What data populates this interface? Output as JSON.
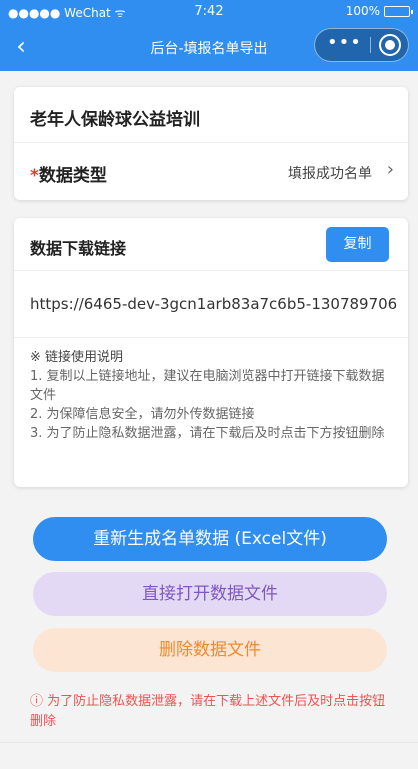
{
  "status_bar": {
    "carrier": "●●●●● WeChat",
    "wifi": "ᯤ",
    "time": "7:42",
    "battery": "100%",
    "battery_level": 1.0
  },
  "nav": {
    "back": "‹",
    "title": "后台-填报名单导出",
    "more": "•••"
  },
  "event_card": {
    "title": "老年人保龄球公益培训",
    "data_type_required_mark": "*",
    "data_type_label": "数据类型",
    "data_type_value": "填报成功名单",
    "chevron": "›"
  },
  "download_card": {
    "label": "数据下载链接",
    "copy_button": "复制",
    "url": "https://6465-dev-3gcn1arb83a7c6b5-130789706",
    "notes_title": "※ 链接使用说明",
    "notes": [
      "1. 复制以上链接地址，建议在电脑浏览器中打开链接下载数据文件",
      "2. 为保障信息安全，请勿外传数据链接",
      "3. 为了防止隐私数据泄露，请在下载后及时点击下方按钮删除"
    ]
  },
  "actions": {
    "regenerate": "重新生成名单数据 (Excel文件)",
    "open_file": "直接打开数据文件",
    "delete_file": "删除数据文件"
  },
  "warning": "ⓘ 为了防止隐私数据泄露，请在下载上述文件后及时点击按钮删除",
  "colors": {
    "primary": "#2f8ef0",
    "purple_bg": "#e4d9f4",
    "purple_text": "#7e57c2",
    "orange_bg": "#fde5d3",
    "orange_text": "#f08a2c",
    "warning": "#ef5350"
  }
}
